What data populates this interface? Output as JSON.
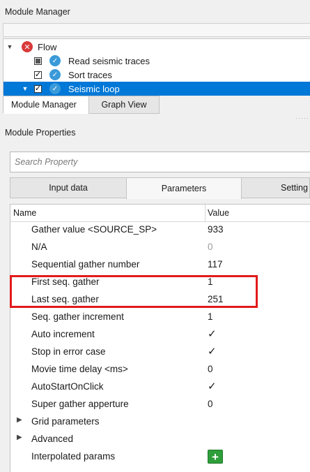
{
  "module_manager": {
    "title": "Module Manager",
    "tree": [
      {
        "label": "Flow",
        "expanded": true,
        "status": "error"
      },
      {
        "label": "Read seismic traces",
        "checked": "partial",
        "status": "ok"
      },
      {
        "label": "Sort traces",
        "checked": true,
        "status": "ok"
      },
      {
        "label": "Seismic loop",
        "checked": true,
        "status": "ok",
        "selected": true
      }
    ],
    "tabs": [
      "Module Manager",
      "Graph View"
    ],
    "active_tab": "Module Manager"
  },
  "module_properties": {
    "title": "Module Properties",
    "search_placeholder": "Search Property",
    "tabs": [
      "Input data",
      "Parameters",
      "Setting"
    ],
    "active_tab": "Parameters",
    "columns": {
      "name": "Name",
      "value": "Value"
    },
    "rows": [
      {
        "name": "Gather value <SOURCE_SP>",
        "value": "933"
      },
      {
        "name": "N/A",
        "value": "0",
        "disabled": true
      },
      {
        "name": "Sequential gather number",
        "value": "117"
      },
      {
        "name": "First seq. gather",
        "value": "1"
      },
      {
        "name": "Last seq. gather",
        "value": "251"
      },
      {
        "name": "Seq. gather increment",
        "value": "1"
      },
      {
        "name": "Auto increment",
        "value": "✓"
      },
      {
        "name": "Stop in error case",
        "value": "✓"
      },
      {
        "name": "Movie time delay <ms>",
        "value": "0"
      },
      {
        "name": "AutoStartOnClick",
        "value": "✓"
      },
      {
        "name": "Super gather apperture",
        "value": "0"
      },
      {
        "name": "Grid parameters",
        "value": "",
        "group": true
      },
      {
        "name": "Advanced",
        "value": "",
        "group": true
      },
      {
        "name": "Interpolated params",
        "value": "+"
      }
    ]
  },
  "colors": {
    "selection": "#0078d7",
    "highlight_box": "#e21a1a",
    "add_button": "#2e9e3a"
  },
  "icons": [
    "expand-arrow-icon",
    "error-status-icon",
    "ok-status-icon",
    "checkbox-icon",
    "add-icon"
  ]
}
